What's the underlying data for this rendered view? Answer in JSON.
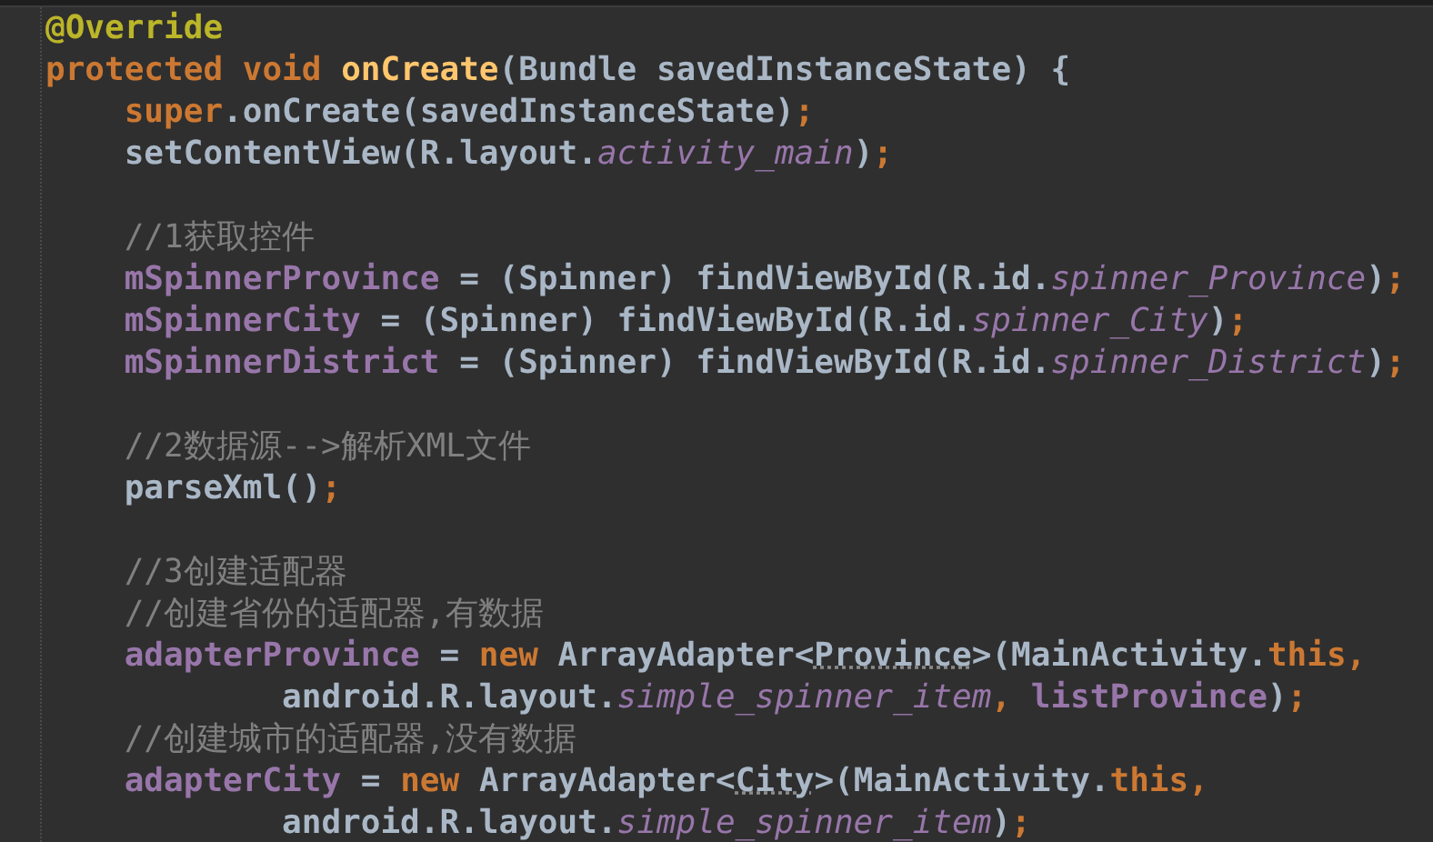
{
  "editor": {
    "lines": [
      {
        "kind": "top",
        "tokens": [
          {
            "kind": "annotation",
            "text": "@Override"
          }
        ]
      },
      {
        "kind": "top",
        "tokens": [
          {
            "kind": "keyword",
            "text": "protected void "
          },
          {
            "kind": "method",
            "text": "onCreate"
          },
          {
            "kind": "plain",
            "text": "(Bundle savedInstanceState) {"
          }
        ]
      },
      {
        "kind": "body",
        "tokens": [
          {
            "kind": "keyword",
            "text": "super"
          },
          {
            "kind": "plain",
            "text": ".onCreate(savedInstanceState)"
          },
          {
            "kind": "keyword",
            "text": ";"
          }
        ]
      },
      {
        "kind": "body",
        "tokens": [
          {
            "kind": "plain",
            "text": "setContentView(R.layout."
          },
          {
            "kind": "static",
            "text": "activity_main"
          },
          {
            "kind": "plain",
            "text": ")"
          },
          {
            "kind": "keyword",
            "text": ";"
          }
        ]
      },
      {
        "kind": "blank"
      },
      {
        "kind": "body",
        "tokens": [
          {
            "kind": "comment",
            "text": "//1获取控件"
          }
        ]
      },
      {
        "kind": "body",
        "tokens": [
          {
            "kind": "field",
            "text": "mSpinnerProvince"
          },
          {
            "kind": "plain",
            "text": " = (Spinner) findViewById(R.id."
          },
          {
            "kind": "static",
            "text": "spinner_Province"
          },
          {
            "kind": "plain",
            "text": ")"
          },
          {
            "kind": "keyword",
            "text": ";"
          }
        ]
      },
      {
        "kind": "body",
        "tokens": [
          {
            "kind": "field",
            "text": "mSpinnerCity"
          },
          {
            "kind": "plain",
            "text": " = (Spinner) findViewById(R.id."
          },
          {
            "kind": "static",
            "text": "spinner_City"
          },
          {
            "kind": "plain",
            "text": ")"
          },
          {
            "kind": "keyword",
            "text": ";"
          }
        ]
      },
      {
        "kind": "body",
        "tokens": [
          {
            "kind": "field",
            "text": "mSpinnerDistrict"
          },
          {
            "kind": "plain",
            "text": " = (Spinner) findViewById(R.id."
          },
          {
            "kind": "static",
            "text": "spinner_District"
          },
          {
            "kind": "plain",
            "text": ")"
          },
          {
            "kind": "keyword",
            "text": ";"
          }
        ]
      },
      {
        "kind": "blank"
      },
      {
        "kind": "body",
        "tokens": [
          {
            "kind": "comment",
            "text": "//2数据源-->解析XML文件"
          }
        ]
      },
      {
        "kind": "body",
        "tokens": [
          {
            "kind": "plain",
            "text": "parseXml()"
          },
          {
            "kind": "keyword",
            "text": ";"
          }
        ]
      },
      {
        "kind": "blank"
      },
      {
        "kind": "body",
        "tokens": [
          {
            "kind": "comment",
            "text": "//3创建适配器"
          }
        ]
      },
      {
        "kind": "body",
        "tokens": [
          {
            "kind": "comment",
            "text": "//创建省份的适配器,有数据"
          }
        ]
      },
      {
        "kind": "body",
        "tokens": [
          {
            "kind": "field",
            "text": "adapterProvince"
          },
          {
            "kind": "plain",
            "text": " = "
          },
          {
            "kind": "keyword",
            "text": "new "
          },
          {
            "kind": "plain",
            "text": "ArrayAdapter<"
          },
          {
            "kind": "typo",
            "text": "Province"
          },
          {
            "kind": "plain",
            "text": ">(MainActivity."
          },
          {
            "kind": "keyword",
            "text": "this,"
          }
        ]
      },
      {
        "kind": "continuation",
        "tokens": [
          {
            "kind": "plain",
            "text": "android.R.layout."
          },
          {
            "kind": "static",
            "text": "simple_spinner_item"
          },
          {
            "kind": "keyword",
            "text": ", "
          },
          {
            "kind": "field",
            "text": "listProvince"
          },
          {
            "kind": "plain",
            "text": ")"
          },
          {
            "kind": "keyword",
            "text": ";"
          }
        ]
      },
      {
        "kind": "body",
        "tokens": [
          {
            "kind": "comment",
            "text": "//创建城市的适配器,没有数据"
          }
        ]
      },
      {
        "kind": "body",
        "tokens": [
          {
            "kind": "field",
            "text": "adapterCity"
          },
          {
            "kind": "plain",
            "text": " = "
          },
          {
            "kind": "keyword",
            "text": "new "
          },
          {
            "kind": "plain",
            "text": "ArrayAdapter<"
          },
          {
            "kind": "typo",
            "text": "City"
          },
          {
            "kind": "plain",
            "text": ">(MainActivity."
          },
          {
            "kind": "keyword",
            "text": "this,"
          }
        ]
      },
      {
        "kind": "continuation",
        "tokens": [
          {
            "kind": "plain",
            "text": "android.R.layout."
          },
          {
            "kind": "static",
            "text": "simple_spinner_item"
          },
          {
            "kind": "plain",
            "text": ")"
          },
          {
            "kind": "keyword",
            "text": ";"
          }
        ]
      }
    ]
  }
}
